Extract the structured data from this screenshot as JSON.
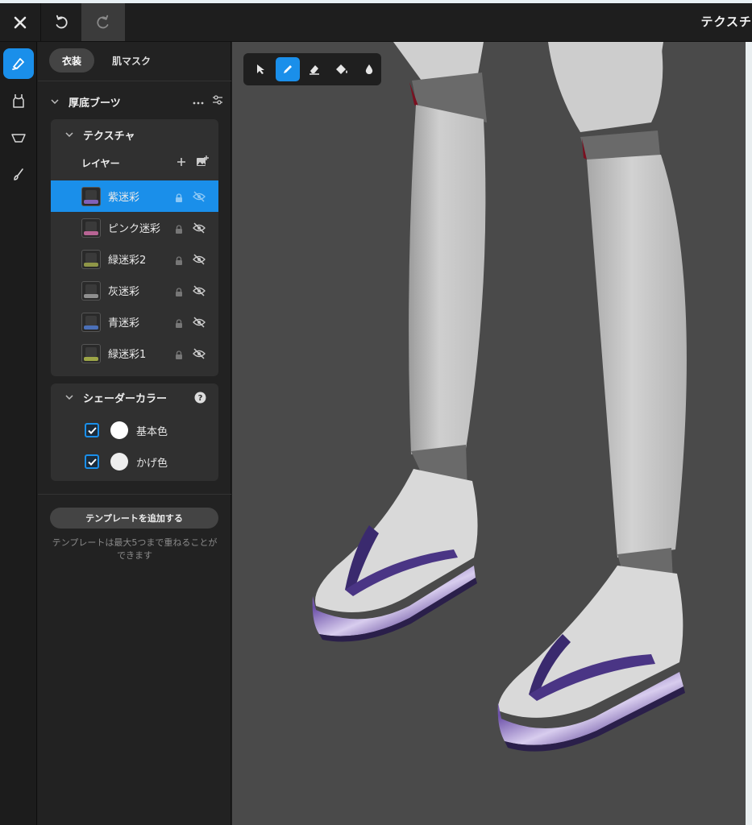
{
  "topbar": {
    "title": "テクスチ",
    "close_icon": "close-icon",
    "undo_icon": "undo-icon",
    "redo_icon": "redo-icon"
  },
  "iconbar": {
    "items": [
      {
        "icon": "brush-tool-icon",
        "active": true
      },
      {
        "icon": "tank-top-icon",
        "active": false
      },
      {
        "icon": "shoe-sole-icon",
        "active": false
      },
      {
        "icon": "paint-brush-icon",
        "active": false
      }
    ]
  },
  "panel": {
    "tabs": [
      {
        "label": "衣装",
        "active": true
      },
      {
        "label": "肌マスク",
        "active": false
      }
    ],
    "section_title": "厚底ブーツ",
    "texture": {
      "title": "テクスチャ",
      "layer_label": "レイヤー",
      "layers": [
        {
          "name": "紫迷彩",
          "selected": true,
          "thumb_color": "#8a66c8"
        },
        {
          "name": "ピンク迷彩",
          "selected": false,
          "thumb_color": "#c86aa0"
        },
        {
          "name": "緑迷彩2",
          "selected": false,
          "thumb_color": "#9aa24a"
        },
        {
          "name": "灰迷彩",
          "selected": false,
          "thumb_color": "#9a9a9a"
        },
        {
          "name": "青迷彩",
          "selected": false,
          "thumb_color": "#4f78c8"
        },
        {
          "name": "緑迷彩1",
          "selected": false,
          "thumb_color": "#a8b24a"
        }
      ]
    },
    "shader": {
      "title": "シェーダーカラー",
      "rows": [
        {
          "label": "基本色",
          "checked": true,
          "color": "#ffffff"
        },
        {
          "label": "かげ色",
          "checked": true,
          "color": "#eeeeee"
        }
      ]
    },
    "add_template_label": "テンプレートを追加する",
    "template_note": "テンプレートは最大5つまで重ねることができます"
  },
  "viewport": {
    "tools": [
      {
        "icon": "select-arrow-icon",
        "active": false
      },
      {
        "icon": "pen-icon",
        "active": true
      },
      {
        "icon": "eraser-icon",
        "active": false
      },
      {
        "icon": "fill-icon",
        "active": false
      },
      {
        "icon": "drop-icon",
        "active": false
      }
    ]
  },
  "colors": {
    "accent": "#1a8fea",
    "panel": "#222222",
    "card": "#303030",
    "viewport": "#4a4a4a",
    "sandal_purple": "#3a2a6e"
  }
}
